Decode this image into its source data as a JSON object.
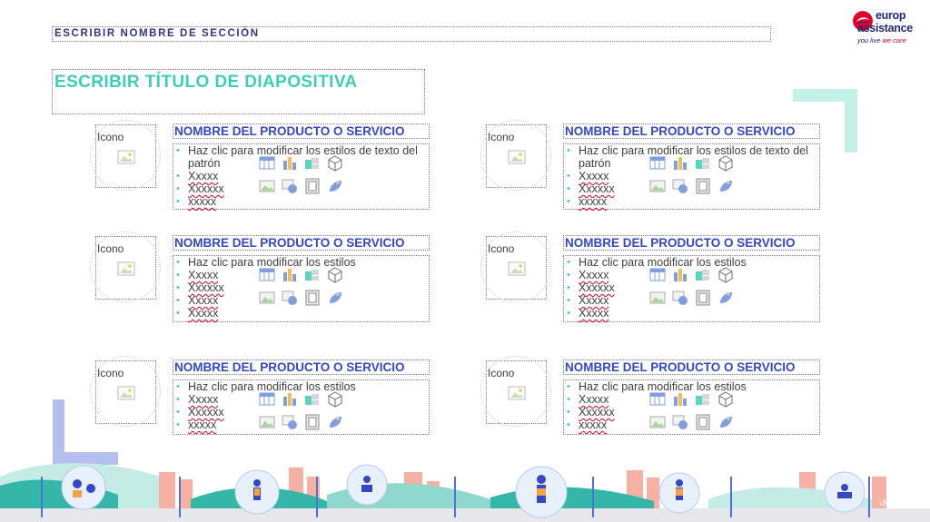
{
  "header": {
    "section": "ESCRIBIR NOMBRE DE SECCIÓN",
    "title": "ESCRIBIR TÍTULO DE DIAPOSITIVA"
  },
  "logo": {
    "line1": "europ",
    "line2": "assistance",
    "tagline_a": "you live ",
    "tagline_b": "we care"
  },
  "colors": {
    "navy": "#1f2a78",
    "teal": "#3ccfb6",
    "blue": "#3448c5",
    "red": "#e1002a",
    "lavender": "#aab4e6"
  },
  "icon_label": "Icono",
  "cards": [
    {
      "title": "NOMBRE DEL PRODUCTO O SERVICIO",
      "items": [
        "Haz clic para modificar los estilos de texto del",
        "patrón",
        "Xxxxx",
        "Xxxxxx",
        "xxxxx"
      ]
    },
    {
      "title": "NOMBRE DEL PRODUCTO O SERVICIO",
      "items": [
        "Haz clic para modificar los estilos de texto del",
        "patrón",
        "Xxxxx",
        "Xxxxxx",
        "xxxxx"
      ]
    },
    {
      "title": "NOMBRE DEL PRODUCTO O SERVICIO",
      "items": [
        "Haz clic para modificar los estilos",
        "Xxxxx",
        "Xxxxxx",
        "Xxxxx",
        "Xxxxx"
      ]
    },
    {
      "title": "NOMBRE DEL PRODUCTO O SERVICIO",
      "items": [
        "Haz clic para modificar los estilos",
        "Xxxxx",
        "Xxxxxx",
        "Xxxxx",
        "Xxxxx"
      ]
    },
    {
      "title": "NOMBRE DEL PRODUCTO O SERVICIO",
      "items": [
        "Haz clic para modificar los estilos",
        "Xxxxx",
        "Xxxxxx",
        "xxxxx"
      ]
    },
    {
      "title": "NOMBRE DEL PRODUCTO O SERVICIO",
      "items": [
        "Haz clic para modificar los estilos",
        "Xxxxx",
        "Xxxxxx",
        "xxxxx"
      ]
    }
  ],
  "insert_icons": [
    "table-icon",
    "chart-icon",
    "smartart-icon",
    "3d-model-icon",
    "picture-icon",
    "online-picture-icon",
    "video-icon",
    "icons-icon"
  ],
  "page_number": "‹Nº›"
}
